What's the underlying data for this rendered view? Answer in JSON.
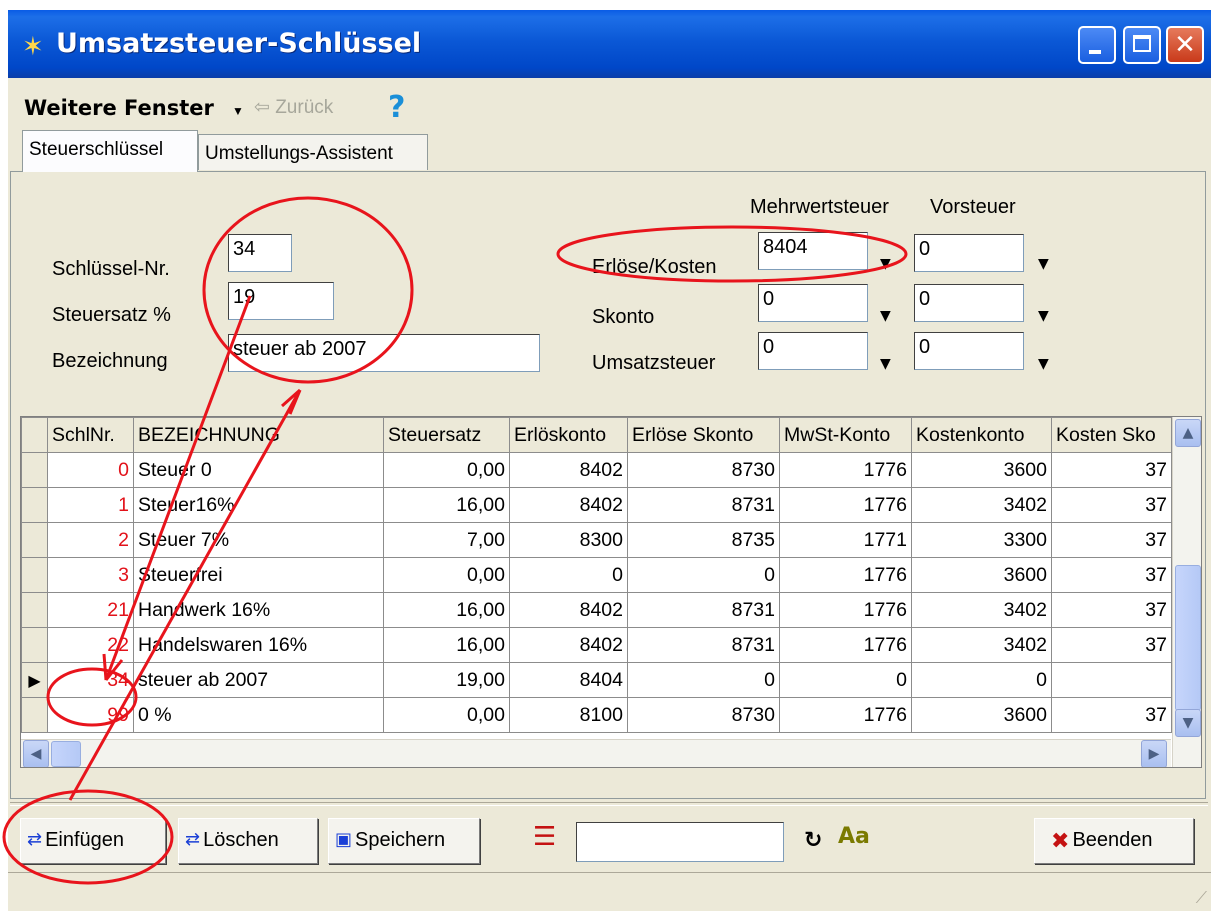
{
  "window": {
    "title": "Umsatzsteuer-Schlüssel",
    "min_label": "",
    "max_label": "",
    "close_label": "✕"
  },
  "menu": {
    "weitere": "Weitere Fenster",
    "zurueck": "⇦ Zurück",
    "help": "?"
  },
  "tabs": [
    "Steuerschlüssel",
    "Umstellungs-Assistent"
  ],
  "form": {
    "col_mwst": "Mehrwertsteuer",
    "col_vorsteuer": "Vorsteuer",
    "schluessel_label": "Schlüssel-Nr.",
    "schluessel_value": "34",
    "steuersatz_label": "Steuersatz %",
    "steuersatz_value": "19",
    "bezeichnung_label": "Bezeichnung",
    "bezeichnung_value": "steuer ab 2007",
    "erloese_label": "Erlöse/Kosten",
    "erloese_mwst": "8404",
    "erloese_vst": "0",
    "skonto_label": "Skonto",
    "skonto_mwst": "0",
    "skonto_vst": "0",
    "ust_label": "Umsatzsteuer",
    "ust_mwst": "0",
    "ust_vst": "0"
  },
  "grid": {
    "headers": [
      "SchlNr.",
      "BEZEICHNUNG",
      "Steuersatz",
      "Erlöskonto",
      "Erlöse Skonto",
      "MwSt-Konto",
      "Kostenkonto",
      "Kosten Sko"
    ],
    "rows": [
      [
        "0",
        "Steuer 0",
        "0,00",
        "8402",
        "8730",
        "1776",
        "3600",
        "37"
      ],
      [
        "1",
        "Steuer16%",
        "16,00",
        "8402",
        "8731",
        "1776",
        "3402",
        "37"
      ],
      [
        "2",
        "Steuer 7%",
        "7,00",
        "8300",
        "8735",
        "1771",
        "3300",
        "37"
      ],
      [
        "3",
        "Steuerfrei",
        "0,00",
        "0",
        "0",
        "1776",
        "3600",
        "37"
      ],
      [
        "21",
        "Handwerk 16%",
        "16,00",
        "8402",
        "8731",
        "1776",
        "3402",
        "37"
      ],
      [
        "22",
        "Handelswaren 16%",
        "16,00",
        "8402",
        "8731",
        "1776",
        "3402",
        "37"
      ],
      [
        "34",
        "steuer ab 2007",
        "19,00",
        "8404",
        "0",
        "0",
        "0",
        ""
      ],
      [
        "99",
        "0 %",
        "0,00",
        "8100",
        "8730",
        "1776",
        "3600",
        "37"
      ]
    ],
    "current_row_marker": "▶"
  },
  "toolbar": {
    "einfuegen": "Einfügen",
    "loeschen": "Löschen",
    "speichern": "Speichern",
    "beenden": "Beenden",
    "aa": "Aa",
    "refresh": "↻"
  },
  "annotation_color": "#e8141c"
}
